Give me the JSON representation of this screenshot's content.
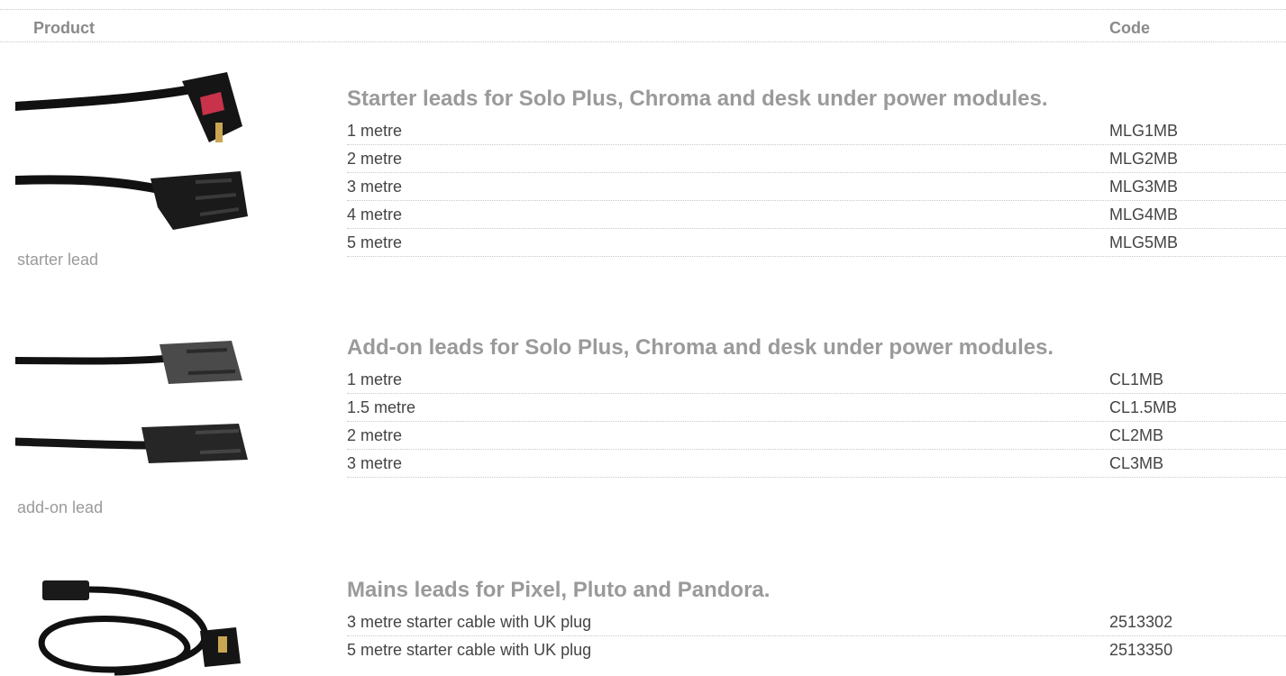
{
  "header": {
    "product": "Product",
    "code": "Code"
  },
  "sections": [
    {
      "title": "Starter leads for Solo Plus, Chroma and desk under power modules.",
      "caption": "starter lead",
      "rows": [
        {
          "desc": "1 metre",
          "code": "MLG1MB"
        },
        {
          "desc": "2 metre",
          "code": "MLG2MB"
        },
        {
          "desc": "3 metre",
          "code": "MLG3MB"
        },
        {
          "desc": "4 metre",
          "code": "MLG4MB"
        },
        {
          "desc": "5 metre",
          "code": "MLG5MB"
        }
      ]
    },
    {
      "title": "Add-on leads for Solo Plus, Chroma and desk under power modules.",
      "caption": "add-on lead",
      "rows": [
        {
          "desc": "1 metre",
          "code": "CL1MB"
        },
        {
          "desc": "1.5 metre",
          "code": "CL1.5MB"
        },
        {
          "desc": "2 metre",
          "code": "CL2MB"
        },
        {
          "desc": "3 metre",
          "code": "CL3MB"
        }
      ]
    },
    {
      "title": "Mains leads for Pixel, Pluto and Pandora.",
      "caption": "",
      "rows": [
        {
          "desc": "3 metre starter cable with UK plug",
          "code": "2513302"
        },
        {
          "desc": "5 metre starter cable with UK plug",
          "code": "2513350"
        }
      ]
    }
  ]
}
